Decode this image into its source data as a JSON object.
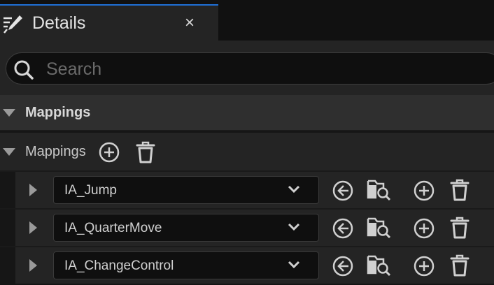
{
  "tab": {
    "title": "Details",
    "close_glyph": "×",
    "icon": "details-pencil-icon"
  },
  "search": {
    "placeholder": "Search",
    "value": ""
  },
  "category": {
    "label": "Mappings",
    "expanded": true
  },
  "array": {
    "label": "Mappings",
    "expanded": true
  },
  "items": [
    {
      "value": "IA_Jump"
    },
    {
      "value": "IA_QuarterMove"
    },
    {
      "value": "IA_ChangeControl"
    }
  ],
  "colors": {
    "accent": "#1f6fd6",
    "panel": "#242424",
    "header": "#2f2f2f",
    "field": "#0f0f0f",
    "icon": "#d0d0d0"
  }
}
